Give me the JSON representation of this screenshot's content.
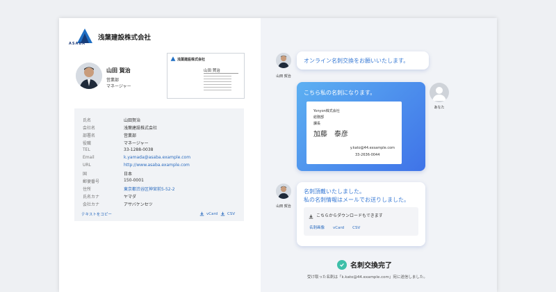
{
  "left": {
    "company": "浅葉建設株式会社",
    "logo_text": "ASABA",
    "profile": {
      "name": "山田 賀治",
      "dept": "営業部",
      "role": "マネージャー"
    },
    "thumb": {
      "company": "浅葉建設株式会社",
      "name_small": "山田 賀治"
    },
    "info_rows": [
      {
        "k": "氏名",
        "v": "山田賀治"
      },
      {
        "k": "会社名",
        "v": "浅葉建設株式会社"
      },
      {
        "k": "部署名",
        "v": "営業部"
      },
      {
        "k": "役職",
        "v": "マネージャー"
      },
      {
        "k": "TEL",
        "v": "33-1288-0038"
      },
      {
        "k": "Email",
        "v": "k.yamada@asaba.example.com"
      },
      {
        "k": "URL",
        "v": "http://www.asaba.example.com"
      },
      {
        "k": "国",
        "v": "日本"
      },
      {
        "k": "郵便番号",
        "v": "150-0001"
      },
      {
        "k": "住所",
        "v": "東京都渋谷区神宮前5-52-2"
      },
      {
        "k": "氏名カナ",
        "v": "ヤマダ"
      },
      {
        "k": "会社カナ",
        "v": "アサバケンセツ"
      }
    ],
    "copy_text": "テキストをコピー",
    "vcard": "vCard",
    "csv": "CSV"
  },
  "right": {
    "msg1": "オンライン名刺交換をお願いいたします。",
    "msg2": "こちら私の名刺になります。",
    "msg3_line1": "名刺頂戴いたしました。",
    "msg3_line2": "私の名刺情報はメールでお送りしました。",
    "sender_name": "山田 賀治",
    "you_label": "あなた",
    "card": {
      "company": "Yonyon株式会社",
      "dept": "総務部",
      "role": "課長",
      "name": "加藤　泰彦",
      "email": "y.kato@44.exsample.com",
      "tel": "33-2636-0044"
    },
    "download": {
      "title": "こちらからダウンロードもできます",
      "links": [
        "名刺画像",
        "vCard",
        "CSV"
      ]
    },
    "complete": "名刺交換完了",
    "footer": "受け取った名刺は「k.kato@44.example.com」宛に送信しました。"
  },
  "colors": {
    "accent": "#3a7bd5",
    "check": "#3ebfa9"
  }
}
